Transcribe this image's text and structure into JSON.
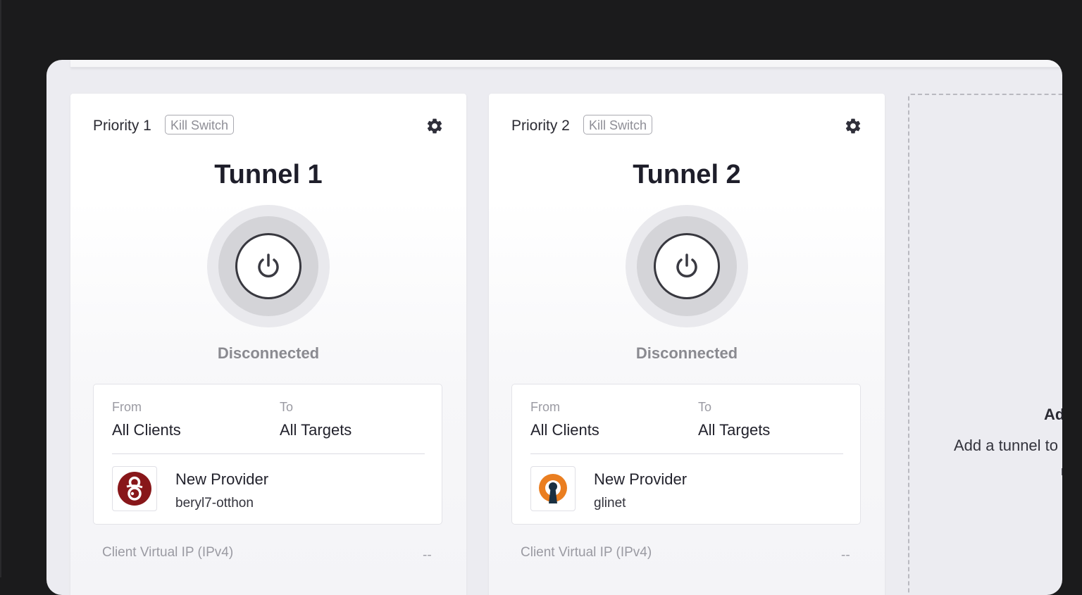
{
  "tunnels": [
    {
      "priority": "Priority 1",
      "kill_switch": "Kill Switch",
      "title": "Tunnel 1",
      "status": "Disconnected",
      "from_label": "From",
      "from_value": "All Clients",
      "to_label": "To",
      "to_value": "All Targets",
      "provider_name": "New Provider",
      "provider_sub": "beryl7-otthon",
      "provider_icon": "wireguard-icon",
      "vip_label": "Client Virtual IP (IPv4)",
      "vip_value": "--"
    },
    {
      "priority": "Priority 2",
      "kill_switch": "Kill Switch",
      "title": "Tunnel 2",
      "status": "Disconnected",
      "from_label": "From",
      "from_value": "All Clients",
      "to_label": "To",
      "to_value": "All Targets",
      "provider_name": "New Provider",
      "provider_sub": "glinet",
      "provider_icon": "openvpn-icon",
      "vip_label": "Client Virtual IP (IPv4)",
      "vip_value": "--"
    }
  ],
  "add_tunnel": {
    "title": "Ad",
    "description": "Add a tunnel to",
    "description_cont": "r"
  },
  "colors": {
    "wireguard": "#88171a",
    "openvpn": "#ea7e20",
    "openvpn_dark": "#1a3041",
    "background": "#1b1b1c",
    "panel": "#ececf1"
  }
}
